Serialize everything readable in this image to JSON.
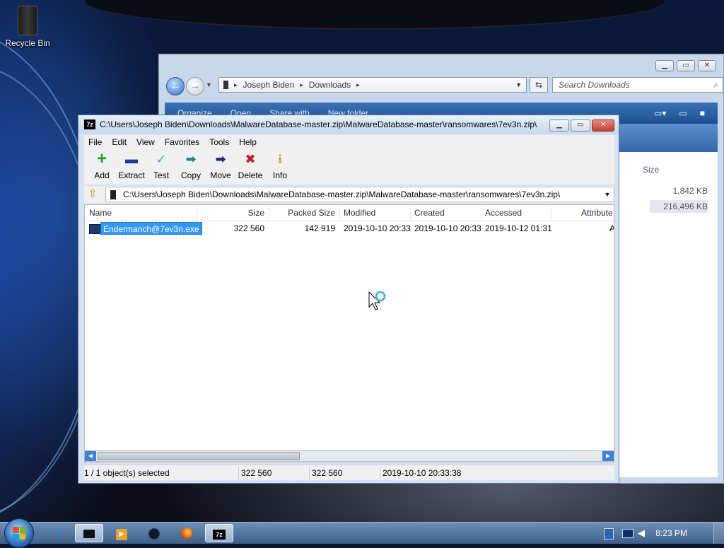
{
  "desktop": {
    "recycle_bin_label": "Recycle Bin"
  },
  "explorer": {
    "breadcrumb": [
      "Joseph Biden",
      "Downloads"
    ],
    "search_placeholder": "Search Downloads",
    "toolbar": [
      "Organize",
      "Open",
      "Share with",
      "New folder"
    ],
    "column_size": "Size",
    "sizes": [
      "1,842 KB",
      "216,496 KB"
    ]
  },
  "sevenzip": {
    "title": "C:\\Users\\Joseph Biden\\Downloads\\MalwareDatabase-master.zip\\MalwareDatabase-master\\ransomwares\\7ev3n.zip\\",
    "app_icon_text": "7z",
    "menu": [
      "File",
      "Edit",
      "View",
      "Favorites",
      "Tools",
      "Help"
    ],
    "tools": [
      {
        "label": "Add",
        "icon": "add-icon",
        "glyph": "+",
        "color": "#1aa31a"
      },
      {
        "label": "Extract",
        "icon": "extract-icon",
        "glyph": "▬",
        "color": "#1e3a9a"
      },
      {
        "label": "Test",
        "icon": "test-icon",
        "glyph": "✓",
        "color": "#19b3c6"
      },
      {
        "label": "Copy",
        "icon": "copy-icon",
        "glyph": "➡",
        "color": "#1f8a8a"
      },
      {
        "label": "Move",
        "icon": "move-icon",
        "glyph": "➡",
        "color": "#1e2a7a"
      },
      {
        "label": "Delete",
        "icon": "delete-icon",
        "glyph": "✖",
        "color": "#d01818"
      },
      {
        "label": "Info",
        "icon": "info-icon",
        "glyph": "i",
        "color": "#c9a200"
      }
    ],
    "path": "C:\\Users\\Joseph Biden\\Downloads\\MalwareDatabase-master.zip\\MalwareDatabase-master\\ransomwares\\7ev3n.zip\\",
    "columns": {
      "name": "Name",
      "size": "Size",
      "packed_size": "Packed Size",
      "modified": "Modified",
      "created": "Created",
      "accessed": "Accessed",
      "attributes": "Attribute"
    },
    "rows": [
      {
        "name": "Endermanch@7ev3n.exe",
        "size": "322 560",
        "packed_size": "142 919",
        "modified": "2019-10-10 20:33",
        "created": "2019-10-10 20:33",
        "accessed": "2019-10-12 01:31",
        "attributes": "A"
      }
    ],
    "status": {
      "selection": "1 / 1 object(s) selected",
      "size": "322 560",
      "packed": "322 560",
      "modified": "2019-10-10 20:33:38"
    }
  },
  "taskbar": {
    "clock": "8:23 PM"
  }
}
